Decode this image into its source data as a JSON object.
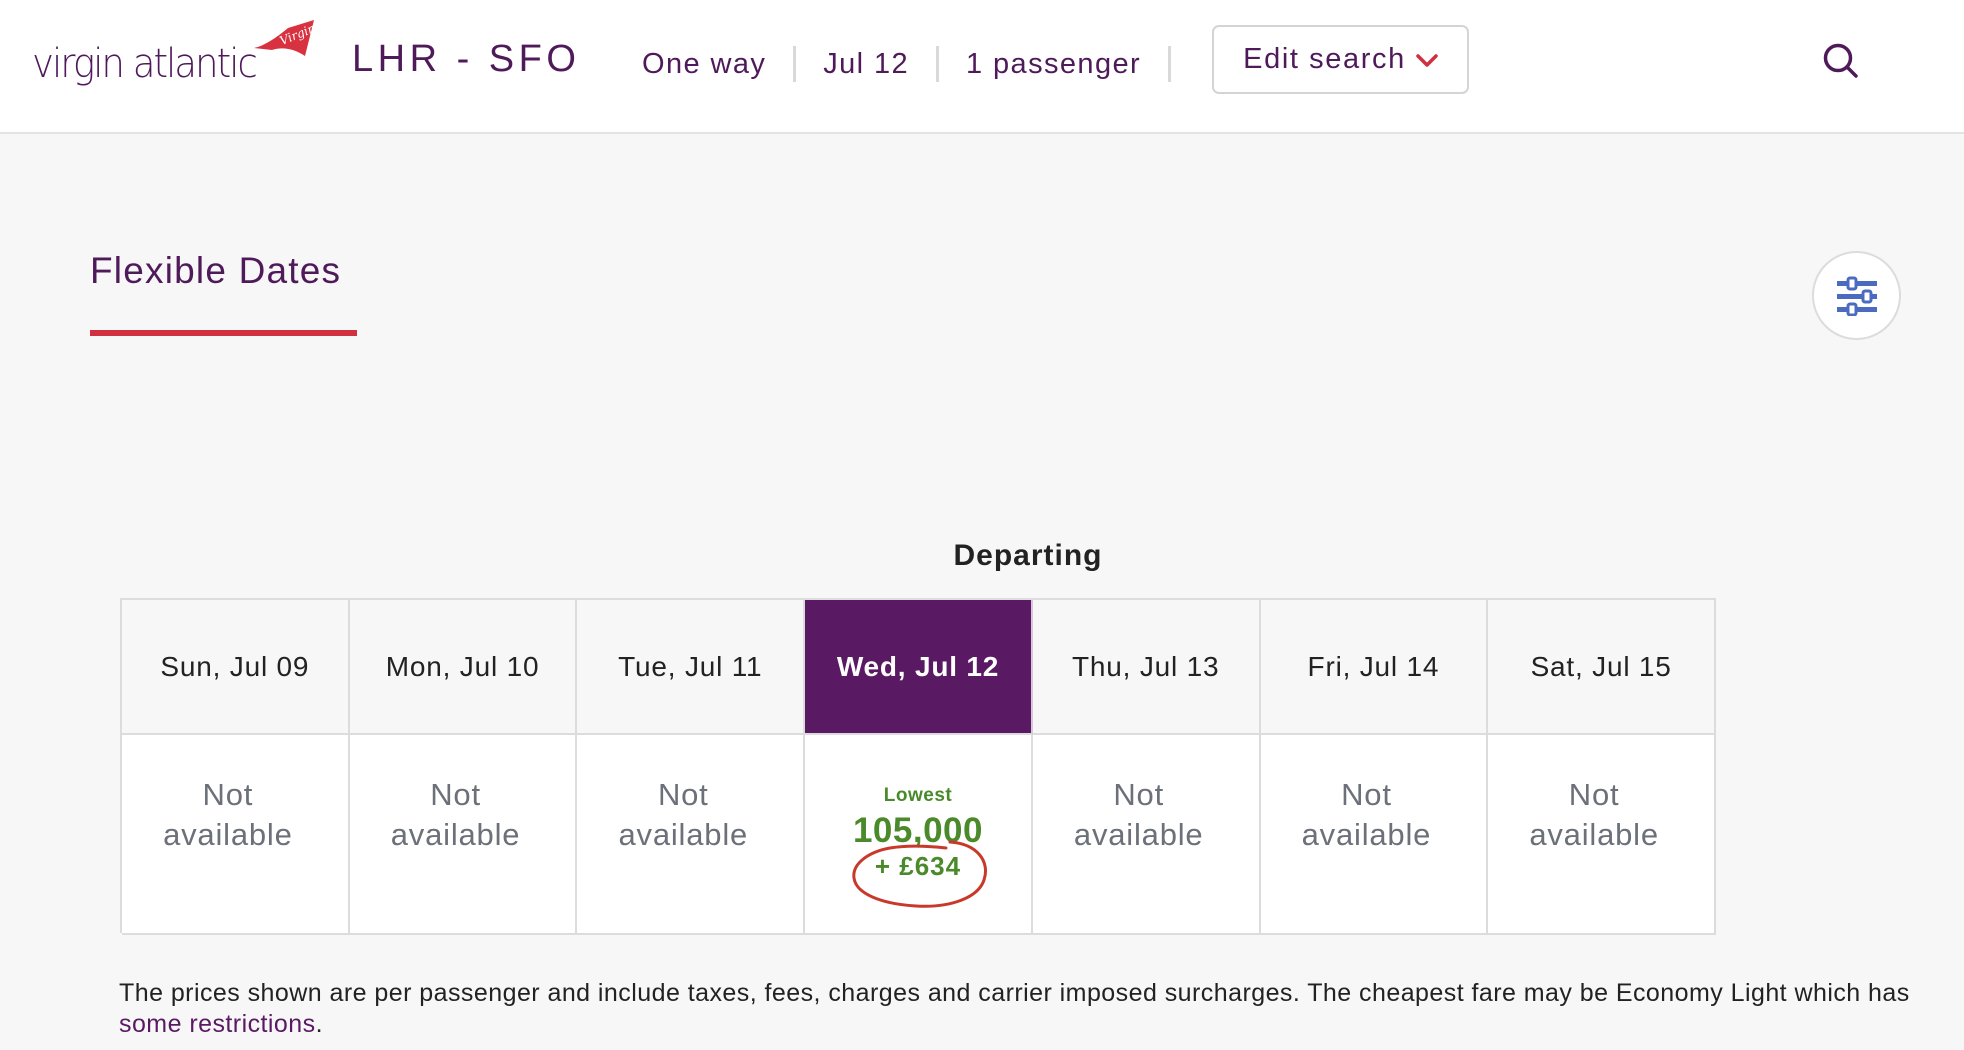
{
  "header": {
    "logo_text": "virgin atlantic",
    "logo_tail_text": "Virgin",
    "route": "LHR - SFO",
    "trip_type": "One way",
    "date": "Jul 12",
    "passengers": "1 passenger",
    "edit_search_label": "Edit search",
    "icons": {
      "edit_search": "chevron-down-icon",
      "search": "search-icon"
    }
  },
  "section": {
    "tab_title": "Flexible Dates",
    "filter_icon": "sliders-icon"
  },
  "calendar": {
    "heading": "Departing",
    "selected_index": 3,
    "days": [
      {
        "label": "Sun, Jul 09",
        "status": "Not available",
        "status_line1": "Not",
        "status_line2": "available"
      },
      {
        "label": "Mon, Jul 10",
        "status": "Not available",
        "status_line1": "Not",
        "status_line2": "available"
      },
      {
        "label": "Tue, Jul 11",
        "status": "Not available",
        "status_line1": "Not",
        "status_line2": "available"
      },
      {
        "label": "Wed, Jul 12",
        "badge": "Lowest",
        "miles": "105,000",
        "cash": "+ £634"
      },
      {
        "label": "Thu, Jul 13",
        "status": "Not available",
        "status_line1": "Not",
        "status_line2": "available"
      },
      {
        "label": "Fri, Jul 14",
        "status": "Not available",
        "status_line1": "Not",
        "status_line2": "available"
      },
      {
        "label": "Sat, Jul 15",
        "status": "Not available",
        "status_line1": "Not",
        "status_line2": "available"
      }
    ]
  },
  "footer": {
    "note_text": "The prices shown are per passenger and include taxes, fees, charges and carrier imposed surcharges. The cheapest fare may be Economy Light which has ",
    "link_text": "some restrictions",
    "note_end": "."
  },
  "colors": {
    "brand_purple": "#4f1a5a",
    "selected_purple": "#5a1a63",
    "accent_red": "#d0303f",
    "fare_green": "#4a8a2a",
    "annotation_red": "#c8392a",
    "filter_blue": "#4a6bbf"
  }
}
